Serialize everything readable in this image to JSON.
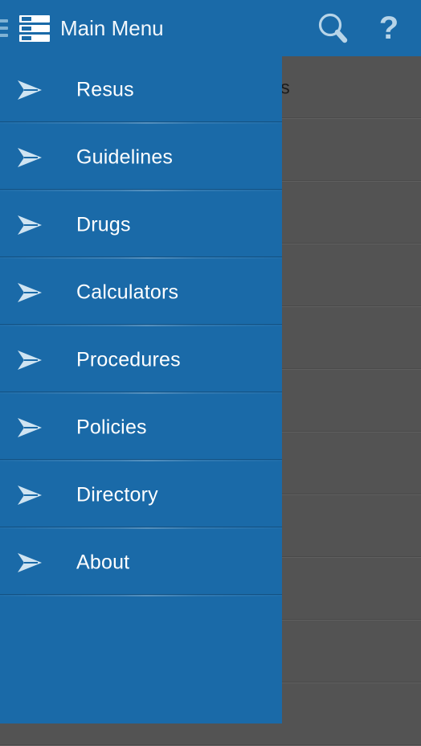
{
  "appbar": {
    "background_color": "#1a6aa8",
    "title": "Main Menu",
    "menu_icon": "list-icon",
    "background_menu_icon": "hamburger-icon",
    "search_icon": "search-icon",
    "help_icon": "help-question-mark-icon",
    "help_glyph": "?"
  },
  "drawer": {
    "background_color": "#1a6aa8",
    "text_color": "#ffffff",
    "item_icon": "arrow-right-icon",
    "items": [
      {
        "label": "Resus"
      },
      {
        "label": "Guidelines"
      },
      {
        "label": "Drugs"
      },
      {
        "label": "Calculators"
      },
      {
        "label": "Procedures"
      },
      {
        "label": "Policies"
      },
      {
        "label": "Directory"
      },
      {
        "label": "About"
      }
    ]
  },
  "background_screen": {
    "background_color": "#535353",
    "rows": [
      {
        "label": "ions"
      },
      {
        "label": ""
      },
      {
        "label": ""
      },
      {
        "label": ""
      },
      {
        "label": ""
      },
      {
        "label": ""
      },
      {
        "label": ""
      },
      {
        "label": ""
      },
      {
        "label": ""
      },
      {
        "label": ""
      },
      {
        "label": ""
      }
    ]
  }
}
